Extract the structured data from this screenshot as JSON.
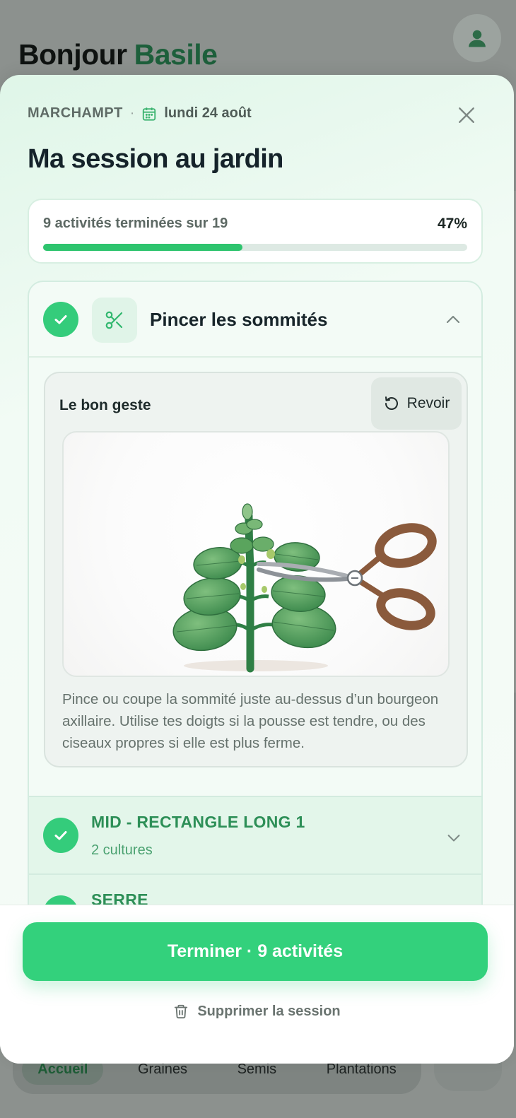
{
  "background": {
    "greeting_hello": "Bonjour",
    "greeting_name": "Basile",
    "avatar_icon": "user-icon",
    "nav": [
      "Accueil",
      "Graines",
      "Semis",
      "Plantations"
    ]
  },
  "session": {
    "location": "MARCHAMPT",
    "separator": "·",
    "date": "lundi 24 août",
    "title": "Ma session au jardin",
    "progress": {
      "text": "9 activités terminées sur 19",
      "percent_label": "47%",
      "fraction": 0.47
    },
    "activity": {
      "title": "Pincer les sommités",
      "tool_icon": "scissors-icon",
      "gesture_label": "Le bon geste",
      "replay_label": "Revoir",
      "description": "Pince ou coupe la sommité juste au-dessus d’un bourgeon axillaire. Utilise tes doigts si la pousse est tendre, ou des ciseaux propres si elle est plus ferme."
    },
    "groups": [
      {
        "title": "MID - RECTANGLE LONG 1",
        "meta": "2 cultures"
      },
      {
        "title": "SERRE",
        "meta": ""
      }
    ],
    "finish_label": "Terminer · 9 activités",
    "delete_label": "Supprimer la session"
  },
  "colors": {
    "accent": "#33d17c",
    "accent_dark": "#2d8f57",
    "name_green": "#1d5f3b"
  }
}
